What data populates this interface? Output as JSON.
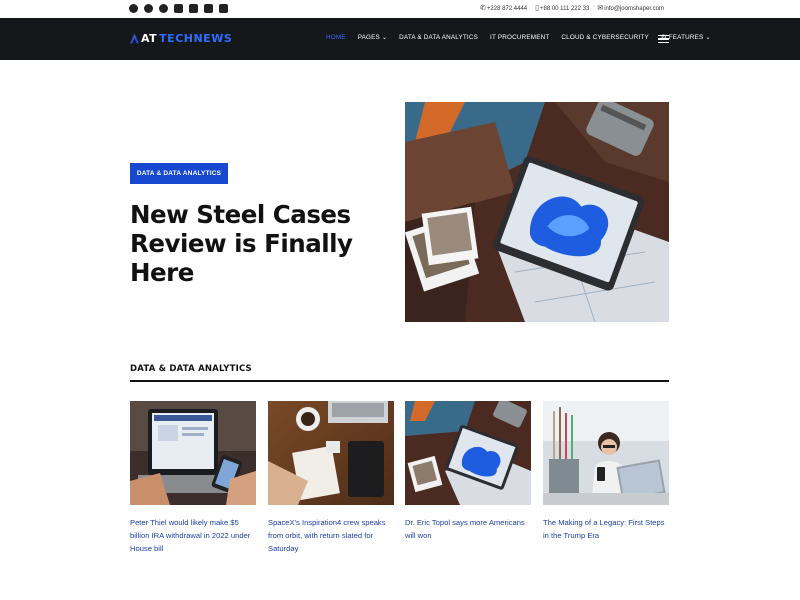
{
  "topbar": {
    "social": [
      "facebook-icon",
      "twitter-icon",
      "pinterest-icon",
      "youtube-icon",
      "linkedin-icon",
      "instagram-icon",
      "flickr-icon"
    ],
    "phone": "+228 872 4444",
    "mobile": "+88 00 111 222 33",
    "email": "info@joomshaper.com"
  },
  "header": {
    "logo_prefix": "AT",
    "logo_name": "TECHNEWS",
    "nav": [
      {
        "label": "HOME",
        "active": true
      },
      {
        "label": "PAGES",
        "dropdown": true
      },
      {
        "label": "DATA & DATA ANALYTICS"
      },
      {
        "label": "IT PROCUREMENT"
      },
      {
        "label": "CLOUD & CYBERSECURITY"
      },
      {
        "label": "FEATURES",
        "dropdown": true
      }
    ],
    "accent": "#2f6dff",
    "background": "#16171b"
  },
  "hero": {
    "category": "DATA & DATA ANALYTICS",
    "title": "New Steel Cases Review is Finally Here"
  },
  "section": {
    "title": "DATA & DATA ANALYTICS",
    "cards": [
      {
        "title": "Peter Thiel would likely make $5 billion IRA withdrawal in 2022 under House bill"
      },
      {
        "title": "SpaceX's Inspiration4 crew speaks from orbit, with return slated for Saturday"
      },
      {
        "title": "Dr. Eric Topol says more Americans will won"
      },
      {
        "title": "The Making of a Legacy: First Steps in the Trump Era"
      }
    ]
  },
  "colors": {
    "badge": "#1848d2",
    "card_title": "#1d3fa8"
  }
}
